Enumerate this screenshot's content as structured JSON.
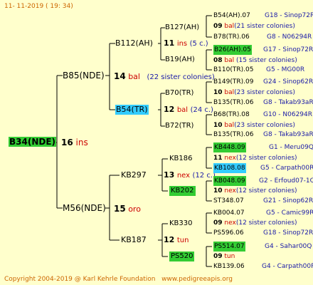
{
  "header": {
    "date": "11- 11-2019 ( 19: 34)"
  },
  "footer": {
    "copyright": "Copyright 2004-2019 @ Karl Kehrle Foundation",
    "site": "www.pedigreeapis.org"
  },
  "colors": {
    "green": "#33cc33",
    "cyan": "#33ccff",
    "red": "#cc0000",
    "blue": "#1a1aa8"
  },
  "root": {
    "name": "B34(NDE)",
    "num": "16",
    "breed": "ins"
  },
  "gen1": [
    {
      "name": "B85(NDE)"
    },
    {
      "name": "M56(NDE)",
      "num": "15",
      "breed": "oro"
    }
  ],
  "gen1_a": {
    "num": "14",
    "breed": "bal",
    "sisters": "(22 sister colonies)"
  },
  "gen2": [
    {
      "name": "B112(AH)",
      "num": "11",
      "breed": "ins",
      "sisters": "(5 c.)"
    },
    {
      "name": "B54(TR)",
      "num": "12",
      "breed": "bal",
      "sisters": "(24 c.)"
    },
    {
      "name": "KB297",
      "num": "13",
      "breed": "nex",
      "sisters": "(12 c.)"
    },
    {
      "name": "KB187",
      "num": "12",
      "breed": "tun"
    }
  ],
  "gen3": [
    {
      "name": "B127(AH)"
    },
    {
      "name": "B19(AH)"
    },
    {
      "name": "B70(TR)"
    },
    {
      "name": "B72(TR)"
    },
    {
      "name": "KB186"
    },
    {
      "name": "KB202"
    },
    {
      "name": "KB330"
    },
    {
      "name": "PS520"
    }
  ],
  "gen4": [
    {
      "name": "B54(AH).07",
      "info": "G18 - Sinop72R"
    },
    {
      "num": "09",
      "breed": "bal",
      "sisters": "(21 sister colonies)"
    },
    {
      "name": "B78(TR).06",
      "info": "G8 - N06294R"
    },
    {
      "name": "B26(AH).05",
      "info": "G17 - Sinop72R"
    },
    {
      "num": "08",
      "breed": "bal",
      "sisters": "(15 sister colonies)"
    },
    {
      "name": "B110(TR).05",
      "info": "G5 - MG00R"
    },
    {
      "name": "B149(TR).09",
      "info": "G24 - Sinop62R"
    },
    {
      "num": "10",
      "breed": "bal",
      "sisters": "(23 sister colonies)"
    },
    {
      "name": "B135(TR).06",
      "info": "G8 - Takab93aR"
    },
    {
      "name": "B68(TR).08",
      "info": "G10 - N06294R"
    },
    {
      "num": "10",
      "breed": "bal",
      "sisters": "(23 sister colonies)"
    },
    {
      "name": "B135(TR).06",
      "info": "G8 - Takab93aR"
    },
    {
      "name": "KB448.09",
      "info": "G1 - Meru09Q"
    },
    {
      "num": "11",
      "breed": "nex",
      "sisters": "(12 sister colonies)"
    },
    {
      "name": "KB108.08",
      "info": "G5 - Carpath00R"
    },
    {
      "name": "KB048.09",
      "info": "G2 - Erfoud07-1Q"
    },
    {
      "num": "10",
      "breed": "nex",
      "sisters": "(12 sister colonies)"
    },
    {
      "name": "ST348.07",
      "info": "G21 - Sinop62R"
    },
    {
      "name": "KB004.07",
      "info": "G5 - Camic99R"
    },
    {
      "num": "09",
      "breed": "nex",
      "sisters": "(12 sister colonies)"
    },
    {
      "name": "PS596.06",
      "info": "G18 - Sinop72R"
    },
    {
      "name": "PS514.07",
      "info": "G4 - Sahar00Q"
    },
    {
      "num": "09",
      "breed": "tun"
    },
    {
      "name": "KB139.06",
      "info": "G4 - Carpath00R"
    }
  ]
}
